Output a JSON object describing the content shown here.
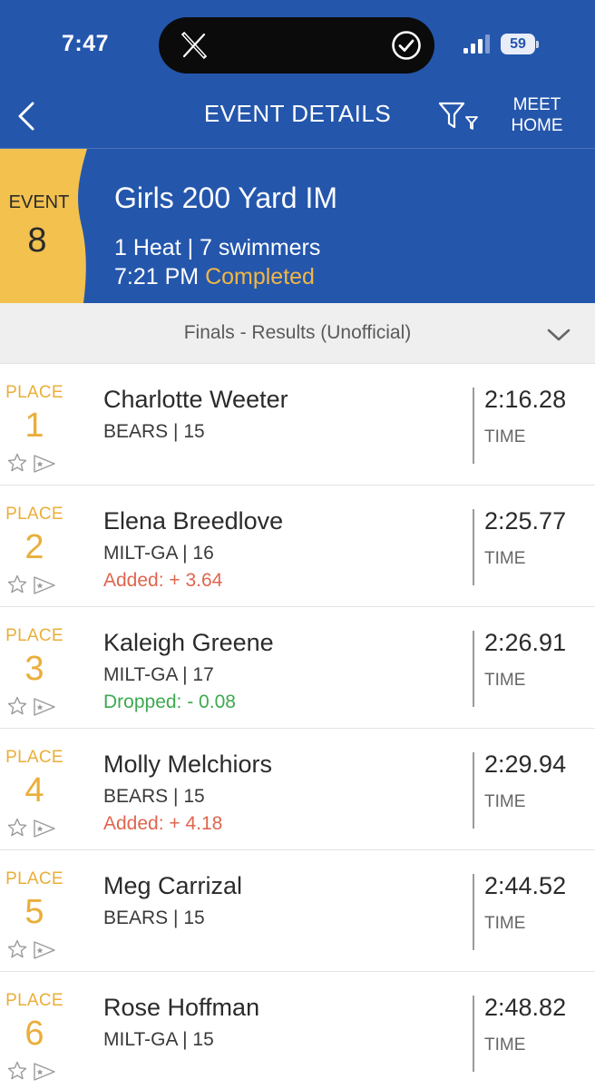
{
  "status_bar": {
    "time": "7:47",
    "battery": "59",
    "island_app_icon": "x-logo-icon",
    "island_status_icon": "check-circle-icon",
    "signal_icon": "cellular-signal-icon"
  },
  "nav": {
    "back_icon": "chevron-left-icon",
    "title": "EVENT DETAILS",
    "filter_icon": "filter-icon",
    "meet_home_line1": "MEET",
    "meet_home_line2": "HOME"
  },
  "event": {
    "label": "EVENT",
    "number": "8",
    "title": "Girls 200 Yard IM",
    "summary": "1 Heat | 7 swimmers",
    "time": "7:21 PM",
    "status": "Completed"
  },
  "results_selector": {
    "label": "Finals - Results (Unofficial)",
    "icon": "chevron-down-icon"
  },
  "results": [
    {
      "place_label": "PLACE",
      "place": "1",
      "name": "Charlotte Weeter",
      "team": "BEARS | 15",
      "delta": "",
      "time": "2:16.28",
      "time_label": "TIME"
    },
    {
      "place_label": "PLACE",
      "place": "2",
      "name": "Elena Breedlove",
      "team": "MILT-GA | 16",
      "delta": "Added: + 3.64",
      "time": "2:25.77",
      "time_label": "TIME"
    },
    {
      "place_label": "PLACE",
      "place": "3",
      "name": "Kaleigh Greene",
      "team": "MILT-GA | 17",
      "delta": "Dropped: - 0.08",
      "time": "2:26.91",
      "time_label": "TIME"
    },
    {
      "place_label": "PLACE",
      "place": "4",
      "name": "Molly Melchiors",
      "team": "BEARS | 15",
      "delta": "Added: + 4.18",
      "time": "2:29.94",
      "time_label": "TIME"
    },
    {
      "place_label": "PLACE",
      "place": "5",
      "name": "Meg Carrizal",
      "team": "BEARS | 15",
      "delta": "",
      "time": "2:44.52",
      "time_label": "TIME"
    },
    {
      "place_label": "PLACE",
      "place": "6",
      "name": "Rose Hoffman",
      "team": "MILT-GA | 15",
      "delta": "",
      "time": "2:48.82",
      "time_label": "TIME"
    }
  ],
  "row_icons": {
    "favorite": "star-icon",
    "share": "flag-icon"
  },
  "colors": {
    "header_blue": "#2456ac",
    "accent_gold": "#f2b745",
    "place_gold": "#eaae3a",
    "added_red": "#e0654e",
    "dropped_green": "#3daa4f"
  }
}
